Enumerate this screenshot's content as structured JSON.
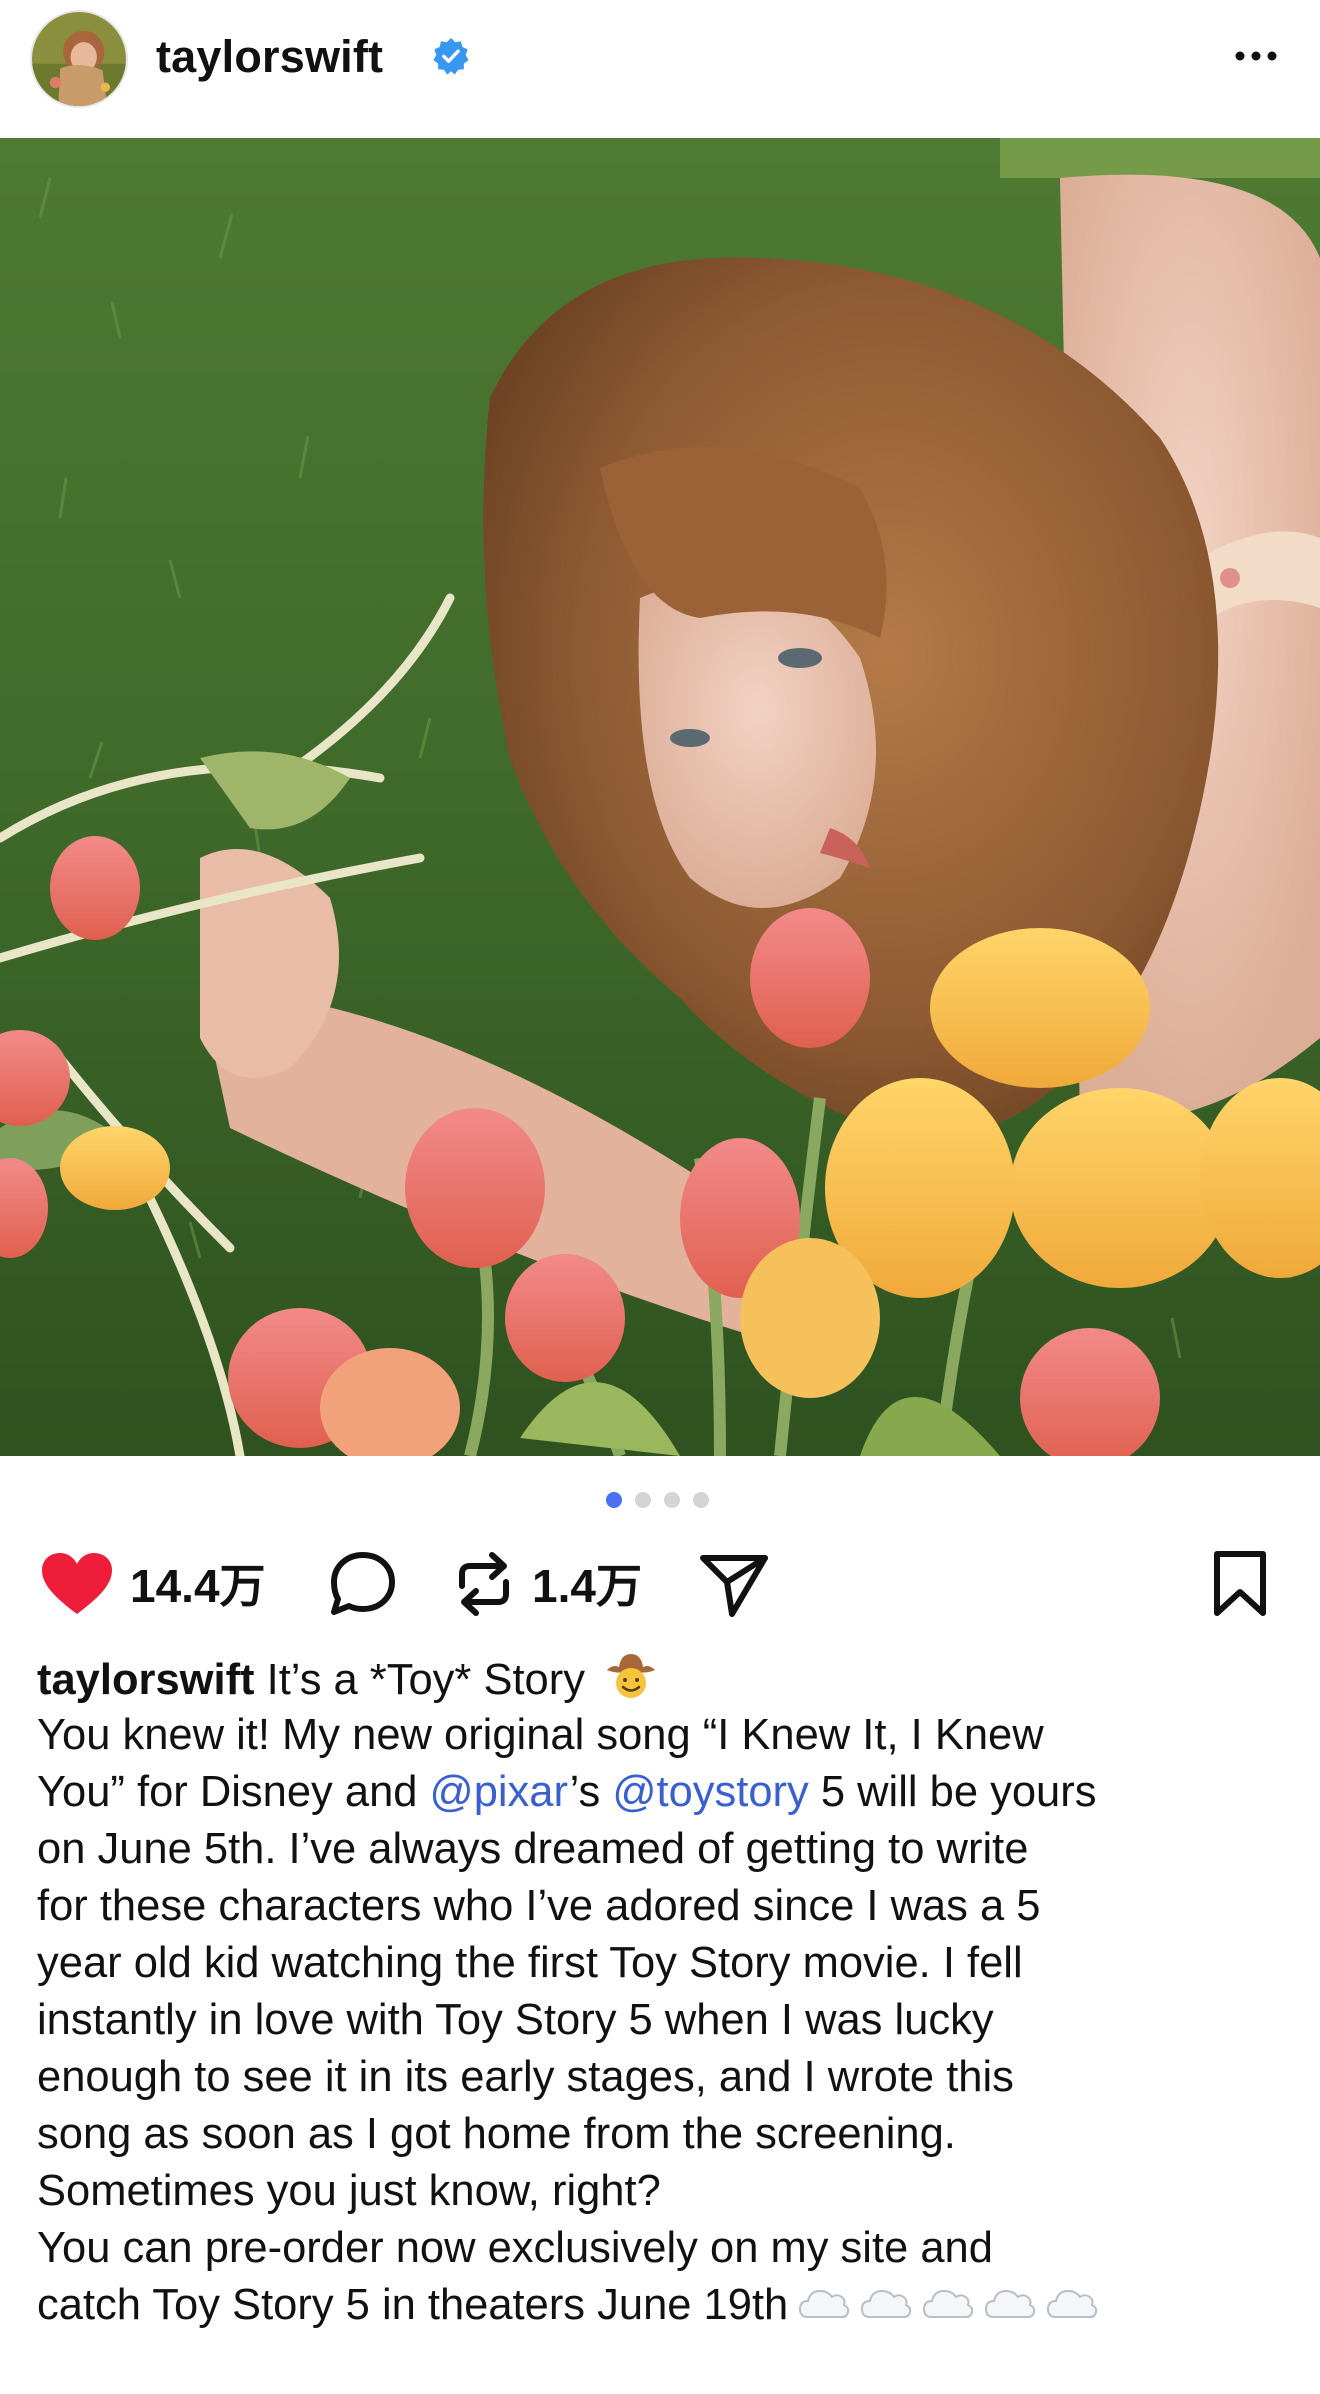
{
  "header": {
    "username": "taylorswift",
    "verified": true,
    "avatar_icon": "profile-avatar",
    "more_icon": "more-dots-icon"
  },
  "photo": {
    "description_icon": "post-photo"
  },
  "carousel": {
    "count": 4,
    "active_index": 0,
    "active_color": "#4b6ef5"
  },
  "actions": {
    "like_icon": "heart-filled-icon",
    "like_count": "14.4万",
    "comment_icon": "comment-bubble-icon",
    "repost_icon": "repost-icon",
    "repost_count": "1.4万",
    "share_icon": "share-send-icon",
    "save_icon": "bookmark-icon",
    "like_color": "#ee1d3a"
  },
  "caption": {
    "username": "taylorswift",
    "title": "It’s a *Toy* Story",
    "lines": [
      "You knew it! My new original song “I Knew It, I Knew",
      [
        "You” for Disney and ",
        "@pixar",
        "’s ",
        "@toystory",
        " 5 will be yours"
      ],
      "on June 5th. I’ve always dreamed of getting to write",
      "for these characters who I’ve adored since I was a 5",
      "year old kid watching the first Toy Story movie. I fell",
      "instantly in love with Toy Story 5 when I was lucky",
      "enough to see it in its early stages, and I wrote this",
      "song as soon as I got home from the screening.",
      "Sometimes you just know, right?",
      "You can pre-order now exclusively on my site and",
      "catch Toy Story 5 in theaters June 19th"
    ],
    "mention_pixar": "@pixar",
    "mention_toystory": "@toystory",
    "mention_color": "#3a5fcf",
    "title_emoji": "cowboy-face-emoji",
    "trailing_emoji": "cloud-emoji",
    "trailing_emoji_count": 5
  }
}
